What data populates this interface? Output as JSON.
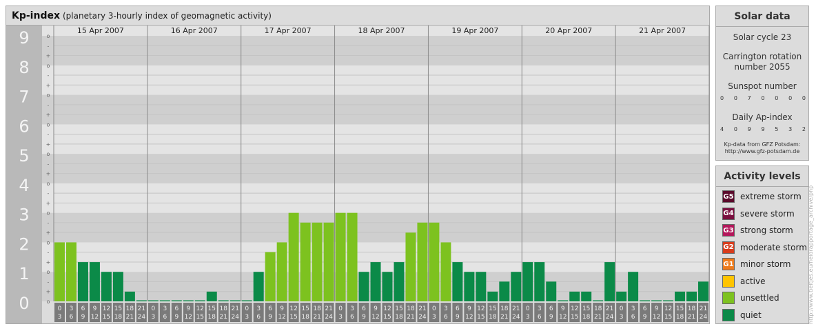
{
  "header": {
    "title": "Kp-index",
    "subtitle": "(planetary 3-hourly index of geomagnetic activity)"
  },
  "solar": {
    "title": "Solar data",
    "solar_cycle": "Solar cycle 23",
    "carrington": "Carrington rotation number 2055",
    "sunspot_label": "Sunspot number",
    "sunspot_values": [
      "0",
      "0",
      "7",
      "0",
      "0",
      "0",
      "0"
    ],
    "ap_label": "Daily Ap-index",
    "ap_values": [
      "4",
      "0",
      "9",
      "9",
      "5",
      "3",
      "2"
    ],
    "credit_line1": "Kp-data from GFZ Potsdam:",
    "credit_line2": "http://www.gfz-potsdam.de"
  },
  "activity": {
    "title": "Activity levels",
    "levels": [
      {
        "code": "G5",
        "label": "extreme storm",
        "color": "#5a0a2a"
      },
      {
        "code": "G4",
        "label": "severe storm",
        "color": "#7a0f3f"
      },
      {
        "code": "G3",
        "label": "strong storm",
        "color": "#b3165a"
      },
      {
        "code": "G2",
        "label": "moderate storm",
        "color": "#d73c1c"
      },
      {
        "code": "G1",
        "label": "minor storm",
        "color": "#ee7a1a"
      },
      {
        "code": "",
        "label": "active",
        "color": "#ffc400"
      },
      {
        "code": "",
        "label": "unsettled",
        "color": "#7dc21f"
      },
      {
        "code": "",
        "label": "quiet",
        "color": "#0b8a48"
      }
    ]
  },
  "watermark": "http://www.tieltjes.eu/fieldrapportage_archive/php",
  "chart_data": {
    "type": "bar",
    "ylim": [
      0,
      9
    ],
    "y_ticks": [
      "0",
      "1",
      "2",
      "3",
      "4",
      "5",
      "6",
      "7",
      "8",
      "9"
    ],
    "minor_tick_labels": [
      "o",
      "+",
      "-"
    ],
    "days": [
      "15 Apr 2007",
      "16 Apr 2007",
      "17 Apr 2007",
      "18 Apr 2007",
      "19 Apr 2007",
      "20 Apr 2007",
      "21 Apr 2007"
    ],
    "slot_top": [
      "0",
      "3",
      "6",
      "9",
      "12",
      "15",
      "18",
      "21"
    ],
    "slot_bottom": [
      "3",
      "6",
      "9",
      "12",
      "15",
      "18",
      "21",
      "24"
    ],
    "colors": {
      "quiet": "#0b8a48",
      "unsettled": "#7dc21f"
    },
    "values": [
      2.0,
      2.0,
      1.33,
      1.33,
      1.0,
      1.0,
      0.33,
      0.0,
      0.0,
      0.0,
      0.0,
      0.0,
      0.0,
      0.33,
      0.0,
      0.0,
      0.0,
      1.0,
      1.67,
      2.0,
      3.0,
      2.67,
      2.67,
      2.67,
      3.0,
      3.0,
      1.0,
      1.33,
      1.0,
      1.33,
      2.33,
      2.67,
      2.67,
      2.0,
      1.33,
      1.0,
      1.0,
      0.33,
      0.67,
      1.0,
      1.33,
      1.33,
      0.67,
      0.0,
      0.33,
      0.33,
      0.0,
      1.33,
      0.33,
      1.0,
      0.0,
      0.0,
      0.0,
      0.33,
      0.33,
      0.67
    ]
  }
}
